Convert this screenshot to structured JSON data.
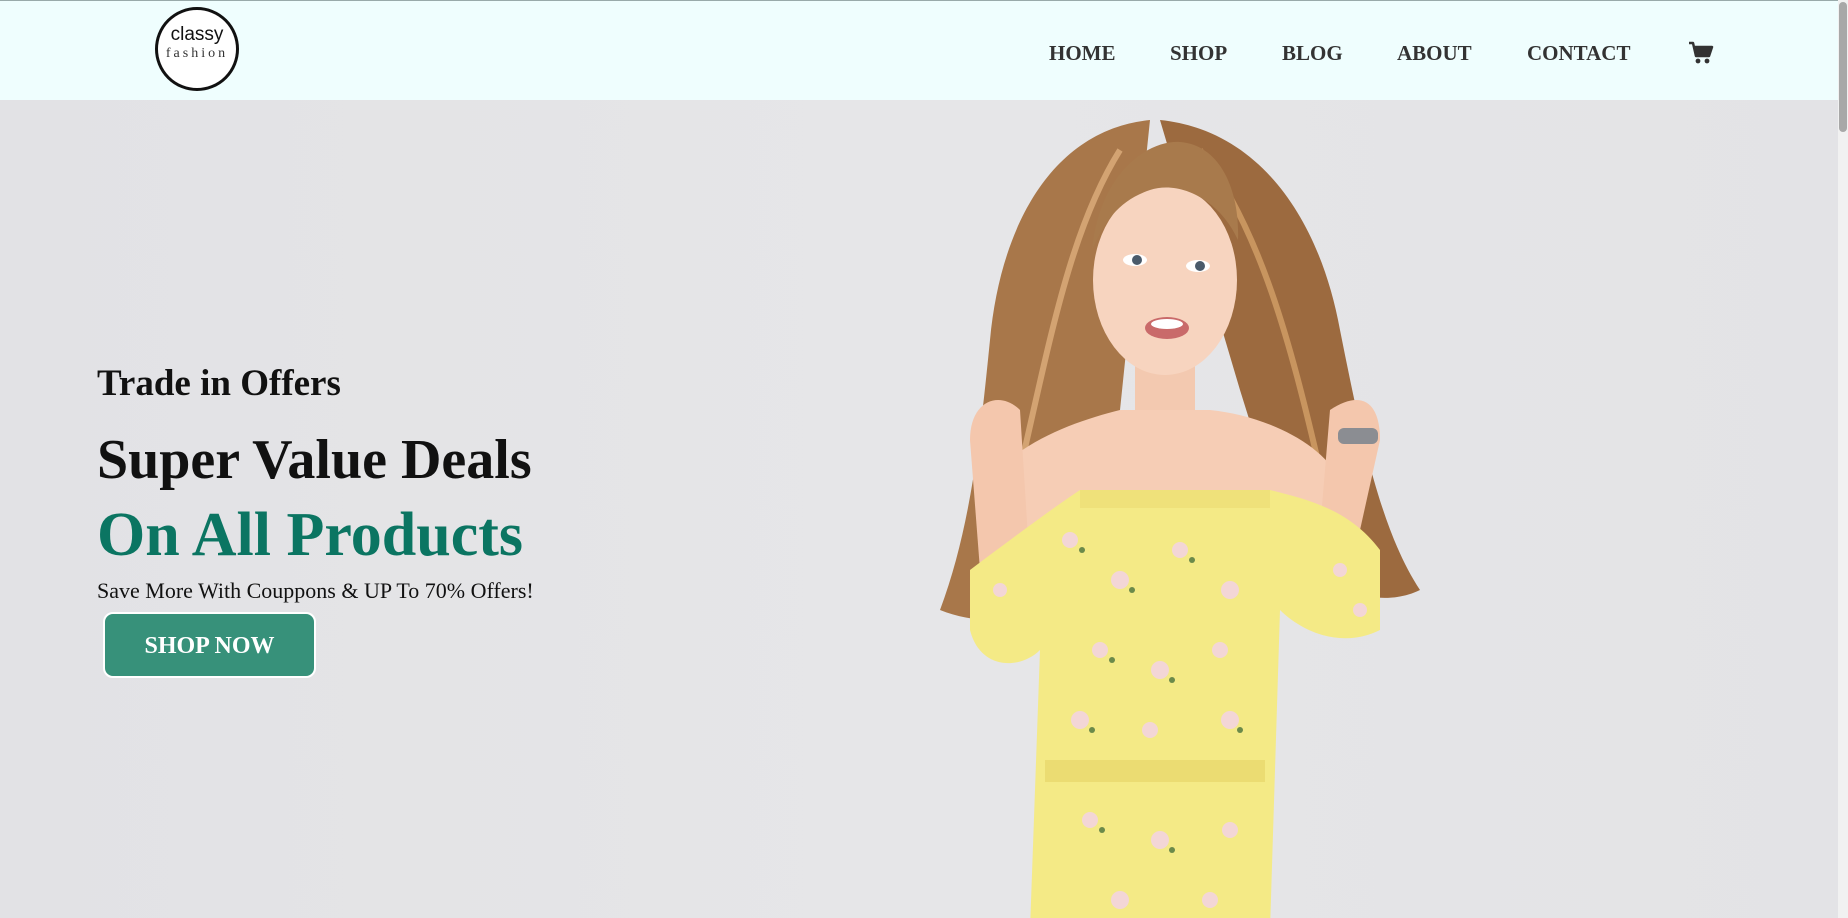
{
  "brand": {
    "logo_line1": "classy",
    "logo_line2": "fashion"
  },
  "nav": {
    "items": [
      {
        "label": "HOME"
      },
      {
        "label": "SHOP"
      },
      {
        "label": "BLOG"
      },
      {
        "label": "ABOUT"
      },
      {
        "label": "CONTACT"
      }
    ],
    "cart_icon": "cart-icon"
  },
  "hero": {
    "eyebrow": "Trade in Offers",
    "headline": "Super Value Deals",
    "headline_accent": "On All Products",
    "subtext": "Save More With Couppons & UP To 70% Offers!",
    "cta_label": "SHOP NOW",
    "image_subject": "model-in-yellow-floral-dress"
  },
  "colors": {
    "header_bg": "#effefe",
    "accent_green": "#0b7562",
    "cta_bg": "#37917a",
    "hero_bg": "#e4e4e6"
  }
}
